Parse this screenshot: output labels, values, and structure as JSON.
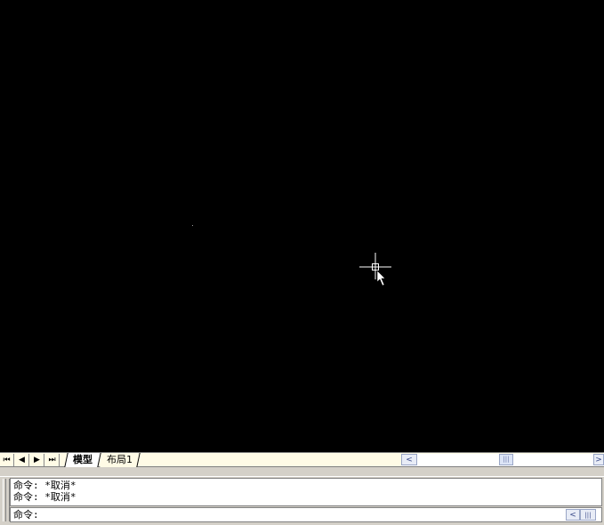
{
  "layout_tabs": {
    "nav": [
      "⏮",
      "◀",
      "▶",
      "⏭"
    ],
    "tabs": [
      {
        "label": "模型",
        "active": true
      },
      {
        "label": "布局1",
        "active": false
      }
    ]
  },
  "scrollbar": {
    "left_arrow": "<",
    "right_arrow": ">",
    "thumb": "|||"
  },
  "command_window": {
    "history": [
      "命令: *取消*",
      "命令: *取消*"
    ],
    "prompt": "命令:"
  },
  "colors": {
    "canvas_bg": "#000000",
    "crosshair": "#ffffff",
    "tabbar_bg": "#fffbe6"
  }
}
